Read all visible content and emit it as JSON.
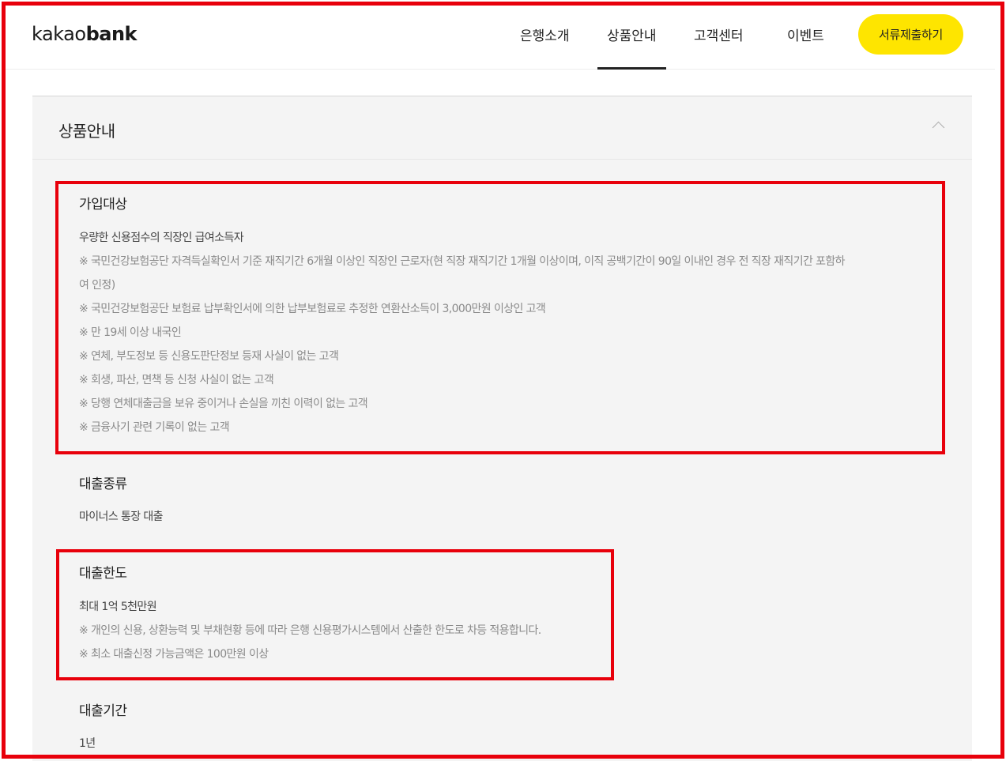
{
  "header": {
    "logo_light": "kakao",
    "logo_bold": "bank",
    "nav": [
      "은행소개",
      "상품안내",
      "고객센터",
      "이벤트"
    ],
    "cta_label": "서류제출하기"
  },
  "panel": {
    "title": "상품안내"
  },
  "sections": {
    "eligibility": {
      "title": "가입대상",
      "main": "우량한 신용점수의 직장인 급여소득자",
      "notes": [
        "※ 국민건강보험공단 자격득실확인서 기준 재직기간 6개월 이상인 직장인 근로자(현 직장 재직기간 1개월 이상이며, 이직 공백기간이 90일 이내인 경우 전 직장 재직기간 포함하",
        "여 인정)",
        "※ 국민건강보험공단 보험료 납부확인서에 의한 납부보험료로 추정한 연환산소득이 3,000만원 이상인 고객",
        "※ 만 19세 이상 내국인",
        "※ 연체, 부도정보 등 신용도판단정보 등재 사실이 없는 고객",
        "※ 회생, 파산, 면책 등 신청 사실이 없는 고객",
        "※ 당행 연체대출금을 보유 중이거나 손실을 끼친 이력이 없는 고객",
        "※ 금융사기 관련 기록이 없는 고객"
      ]
    },
    "loan_type": {
      "title": "대출종류",
      "main": "마이너스 통장 대출"
    },
    "loan_limit": {
      "title": "대출한도",
      "main": "최대 1억 5천만원",
      "notes": [
        "※ 개인의 신용, 상환능력 및 부채현황 등에 따라 은행 신용평가시스템에서 산출한 한도로 차등 적용합니다.",
        "※ 최소 대출신정 가능금액은 100만원 이상"
      ]
    },
    "loan_term": {
      "title": "대출기간",
      "main": "1년"
    }
  },
  "colors": {
    "accent_yellow": "#fee500",
    "highlight_red": "#e8000b",
    "panel_bg": "#f4f4f4"
  },
  "icons": {
    "collapse": "chevron-up-icon"
  }
}
